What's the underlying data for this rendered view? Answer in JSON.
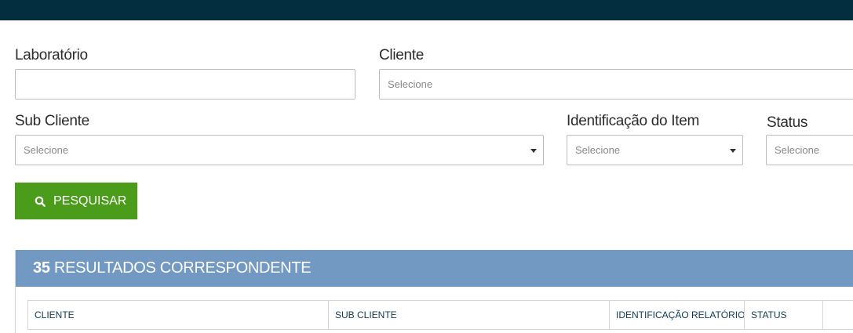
{
  "filters": {
    "laboratorio": {
      "label": "Laboratório",
      "value": ""
    },
    "cliente": {
      "label": "Cliente",
      "placeholder": "Selecione"
    },
    "sub_cliente": {
      "label": "Sub Cliente",
      "placeholder": "Selecione"
    },
    "identificacao_item": {
      "label": "Identificação do Item",
      "placeholder": "Selecione"
    },
    "status": {
      "label": "Status",
      "placeholder": "Selecione"
    }
  },
  "search_button": {
    "label": "PESQUISAR",
    "icon": "search-icon"
  },
  "results": {
    "count": "35",
    "title": "RESULTADOS CORRESPONDENTE",
    "columns": [
      "CLIENTE",
      "SUB CLIENTE",
      "IDENTIFICAÇÃO RELATÓRIO",
      "STATUS",
      ""
    ]
  },
  "colors": {
    "topbar": "#022e40",
    "button": "#4c9c1c",
    "results_header": "#7299c2",
    "column_text": "#0d3a57"
  }
}
